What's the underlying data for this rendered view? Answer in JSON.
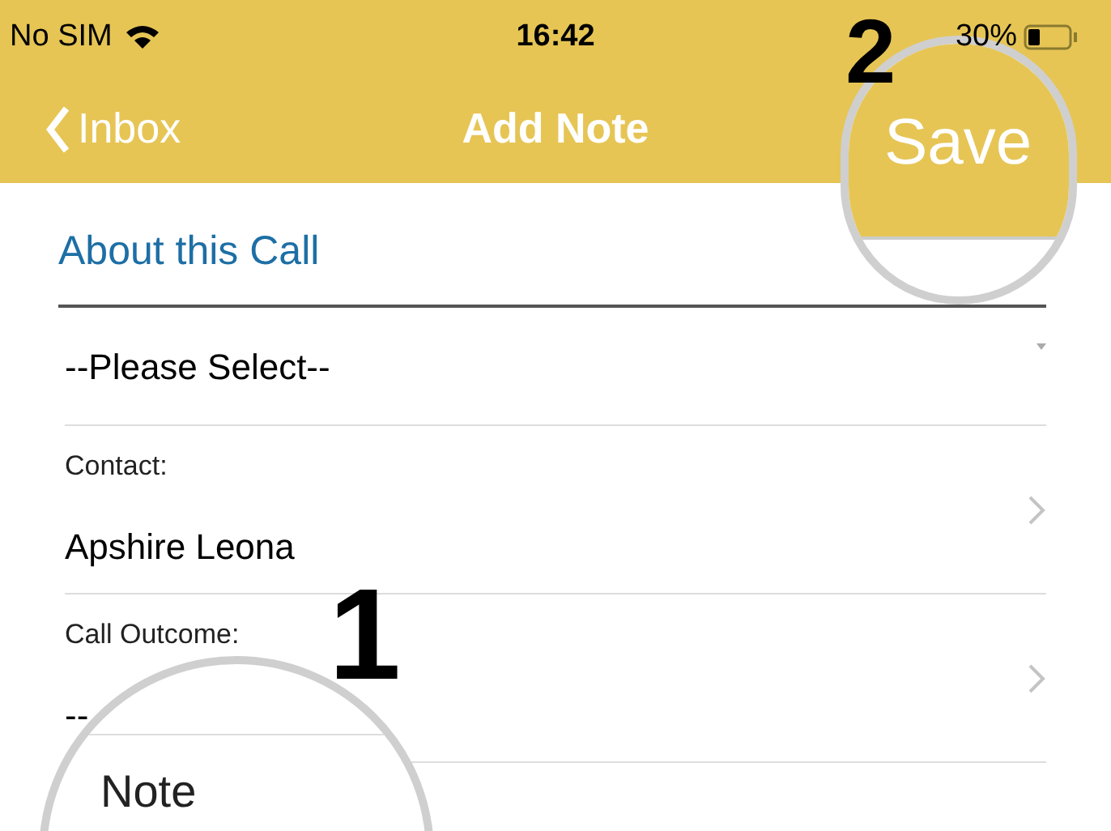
{
  "status_bar": {
    "carrier": "No SIM",
    "time": "16:42",
    "battery_text": "30%"
  },
  "nav": {
    "back": "Inbox",
    "title": "Add Note"
  },
  "section_title": "About this Call",
  "rows": [
    {
      "kind": "select",
      "value": "--Please Select--"
    },
    {
      "kind": "picker",
      "label": "Contact:",
      "value": "Apshire Leona"
    },
    {
      "kind": "picker",
      "label": "Call Outcome:",
      "value": "--"
    }
  ],
  "callouts": [
    {
      "number": "1",
      "text": "Note"
    },
    {
      "number": "2",
      "text": "Save"
    }
  ]
}
